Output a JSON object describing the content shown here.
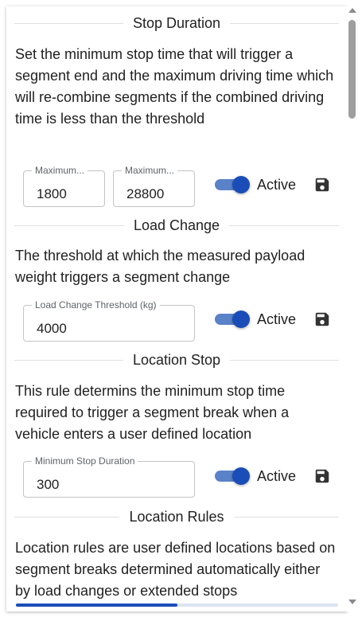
{
  "sections": [
    {
      "title": "Stop Duration",
      "description": "Set the minimum stop time that will trigger a segment end and the maximum driving time which will re-combine segments if the combined driving time is less than the threshold",
      "fields": [
        {
          "label": "Maximum...",
          "value": "1800"
        },
        {
          "label": "Maximum...",
          "value": "28800"
        }
      ],
      "toggle": {
        "label": "Active",
        "on": true
      }
    },
    {
      "title": "Load Change",
      "description": "The threshold at which the measured payload weight triggers a segment change",
      "fields": [
        {
          "label": "Load Change Threshold (kg)",
          "value": "4000"
        }
      ],
      "toggle": {
        "label": "Active",
        "on": true
      }
    },
    {
      "title": "Location Stop",
      "description": "This rule determins the minimum stop time required to trigger a segment break when a vehicle enters a user defined location",
      "fields": [
        {
          "label": "Minimum Stop Duration",
          "value": "300"
        }
      ],
      "toggle": {
        "label": "Active",
        "on": true
      }
    },
    {
      "title": "Location Rules",
      "description": "Location rules are user defined locations based on segment breaks determined automatically either by load changes or extended stops"
    }
  ],
  "icons": {
    "save": "save-icon",
    "scroll_up": "arrow-up-icon",
    "scroll_down": "arrow-down-icon"
  },
  "progress": {
    "fraction": 0.5
  },
  "colors": {
    "accent": "#1a4db8",
    "track": "#5a82c8",
    "text": "#212121",
    "label": "#5f6368"
  }
}
